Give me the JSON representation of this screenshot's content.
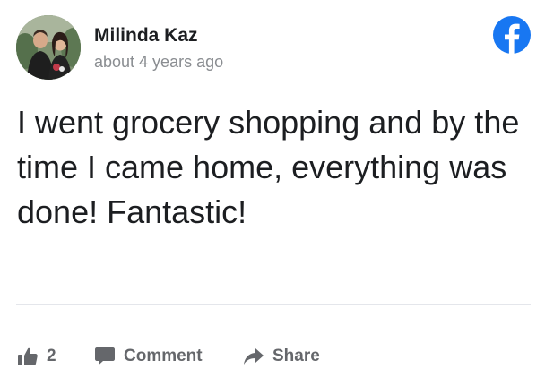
{
  "post": {
    "author": "Milinda Kaz",
    "timestamp": "about 4 years ago",
    "text": "I went grocery shopping and by the time I came home, everything was done! Fantastic!"
  },
  "actions": {
    "like_count": "2",
    "comment_label": "Comment",
    "share_label": "Share"
  },
  "icons": {
    "brand": "facebook-logo-icon",
    "like": "thumbs-up-icon",
    "comment": "speech-bubble-icon",
    "share": "share-arrow-icon"
  },
  "colors": {
    "facebook_blue": "#1877f2",
    "action_gray": "#65676b",
    "timestamp_gray": "#8a8d91",
    "text_dark": "#1c1e21"
  }
}
